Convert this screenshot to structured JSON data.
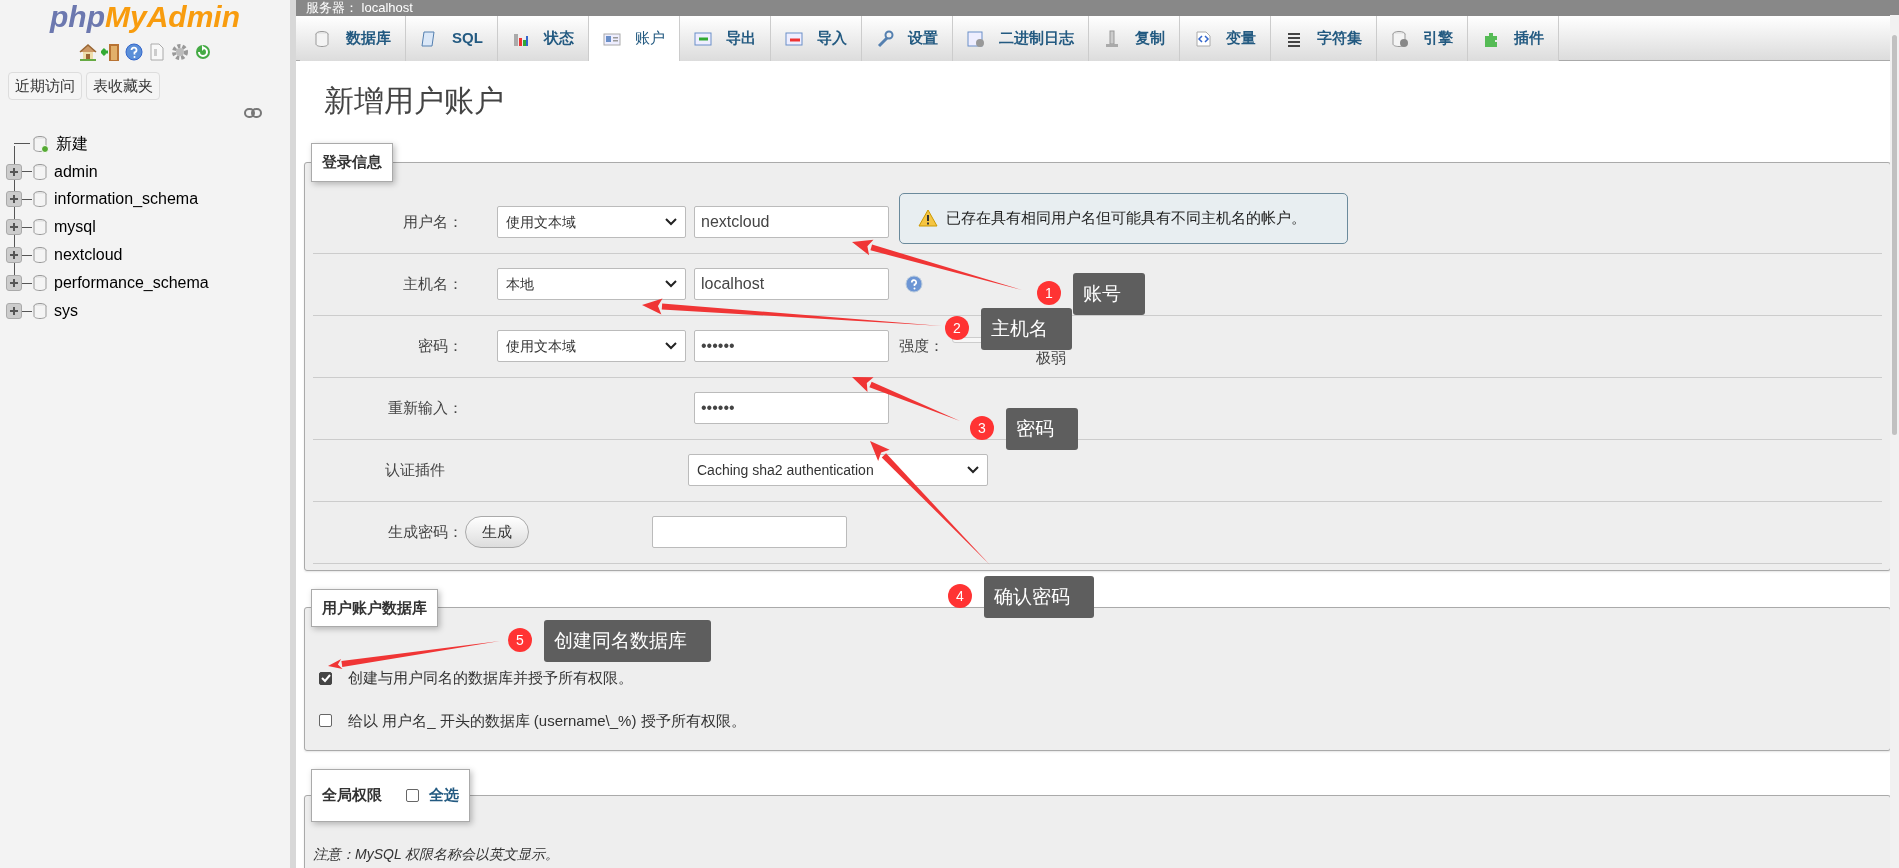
{
  "sidebar": {
    "logo": {
      "part_1": "php",
      "part_2": "MyAdmin"
    },
    "buttons": [
      "近期访问",
      "表收藏夹"
    ],
    "tree": [
      {
        "kind": "new",
        "label": "新建"
      },
      {
        "kind": "database",
        "label": "admin",
        "expanded": false
      },
      {
        "kind": "database",
        "label": "information_schema",
        "expanded": false
      },
      {
        "kind": "database",
        "label": "mysql",
        "expanded": false
      },
      {
        "kind": "database",
        "label": "nextcloud",
        "expanded": false
      },
      {
        "kind": "database",
        "label": "performance_schema",
        "expanded": false
      },
      {
        "kind": "database",
        "label": "sys",
        "expanded": false
      }
    ]
  },
  "server_bar": {
    "title": "服务器： localhost"
  },
  "tabs": [
    {
      "label": "数据库",
      "selected": false
    },
    {
      "label": "SQL",
      "selected": false
    },
    {
      "label": "状态",
      "selected": false
    },
    {
      "label": "账户",
      "selected": true
    },
    {
      "label": "导出",
      "selected": false
    },
    {
      "label": "导入",
      "selected": false
    },
    {
      "label": "设置",
      "selected": false
    },
    {
      "label": "二进制日志",
      "selected": false
    },
    {
      "label": "复制",
      "selected": false
    },
    {
      "label": "变量",
      "selected": false
    },
    {
      "label": "字符集",
      "selected": false
    },
    {
      "label": "引擎",
      "selected": false
    },
    {
      "label": "插件",
      "selected": false
    }
  ],
  "page_title": "新增用户账户",
  "login_info": {
    "legend": "登录信息",
    "rows": [
      {
        "kind": "username",
        "label": "用户名：",
        "select": "使用文本域",
        "value": "nextcloud",
        "notice": "已存在具有相同用户名但可能具有不同主机名的帐户。"
      },
      {
        "kind": "host",
        "label": "主机名：",
        "select": "本地",
        "value": "localhost"
      },
      {
        "kind": "password",
        "label": "密码：",
        "select": "使用文本域",
        "value": "••••••",
        "strength_label": "强度：",
        "level": 0,
        "strength": "极弱"
      },
      {
        "kind": "retype",
        "label": "重新输入：",
        "value": "••••••"
      },
      {
        "kind": "plugin",
        "label": "认证插件",
        "select": "Caching sha2 authentication"
      },
      {
        "kind": "generate",
        "label": "生成密码：",
        "button": "生成"
      }
    ]
  },
  "user_database": {
    "legend": "用户账户数据库",
    "options": [
      {
        "label": "创建与用户同名的数据库并授予所有权限。",
        "checked": true
      },
      {
        "label": "给以 用户名_ 开头的数据库 (username\\_%) 授予所有权限。",
        "checked": false
      }
    ]
  },
  "global_privileges": {
    "legend": "全局权限",
    "select_all": {
      "label": "全选",
      "checked": false
    },
    "note": "注意：MySQL 权限名称会以英文显示。"
  },
  "annotations": [
    {
      "number": "1",
      "label": "账号"
    },
    {
      "number": "2",
      "label": "主机名"
    },
    {
      "number": "3",
      "label": "密码"
    },
    {
      "number": "4",
      "label": "确认密码"
    },
    {
      "number": "5",
      "label": "创建同名数据库"
    }
  ]
}
